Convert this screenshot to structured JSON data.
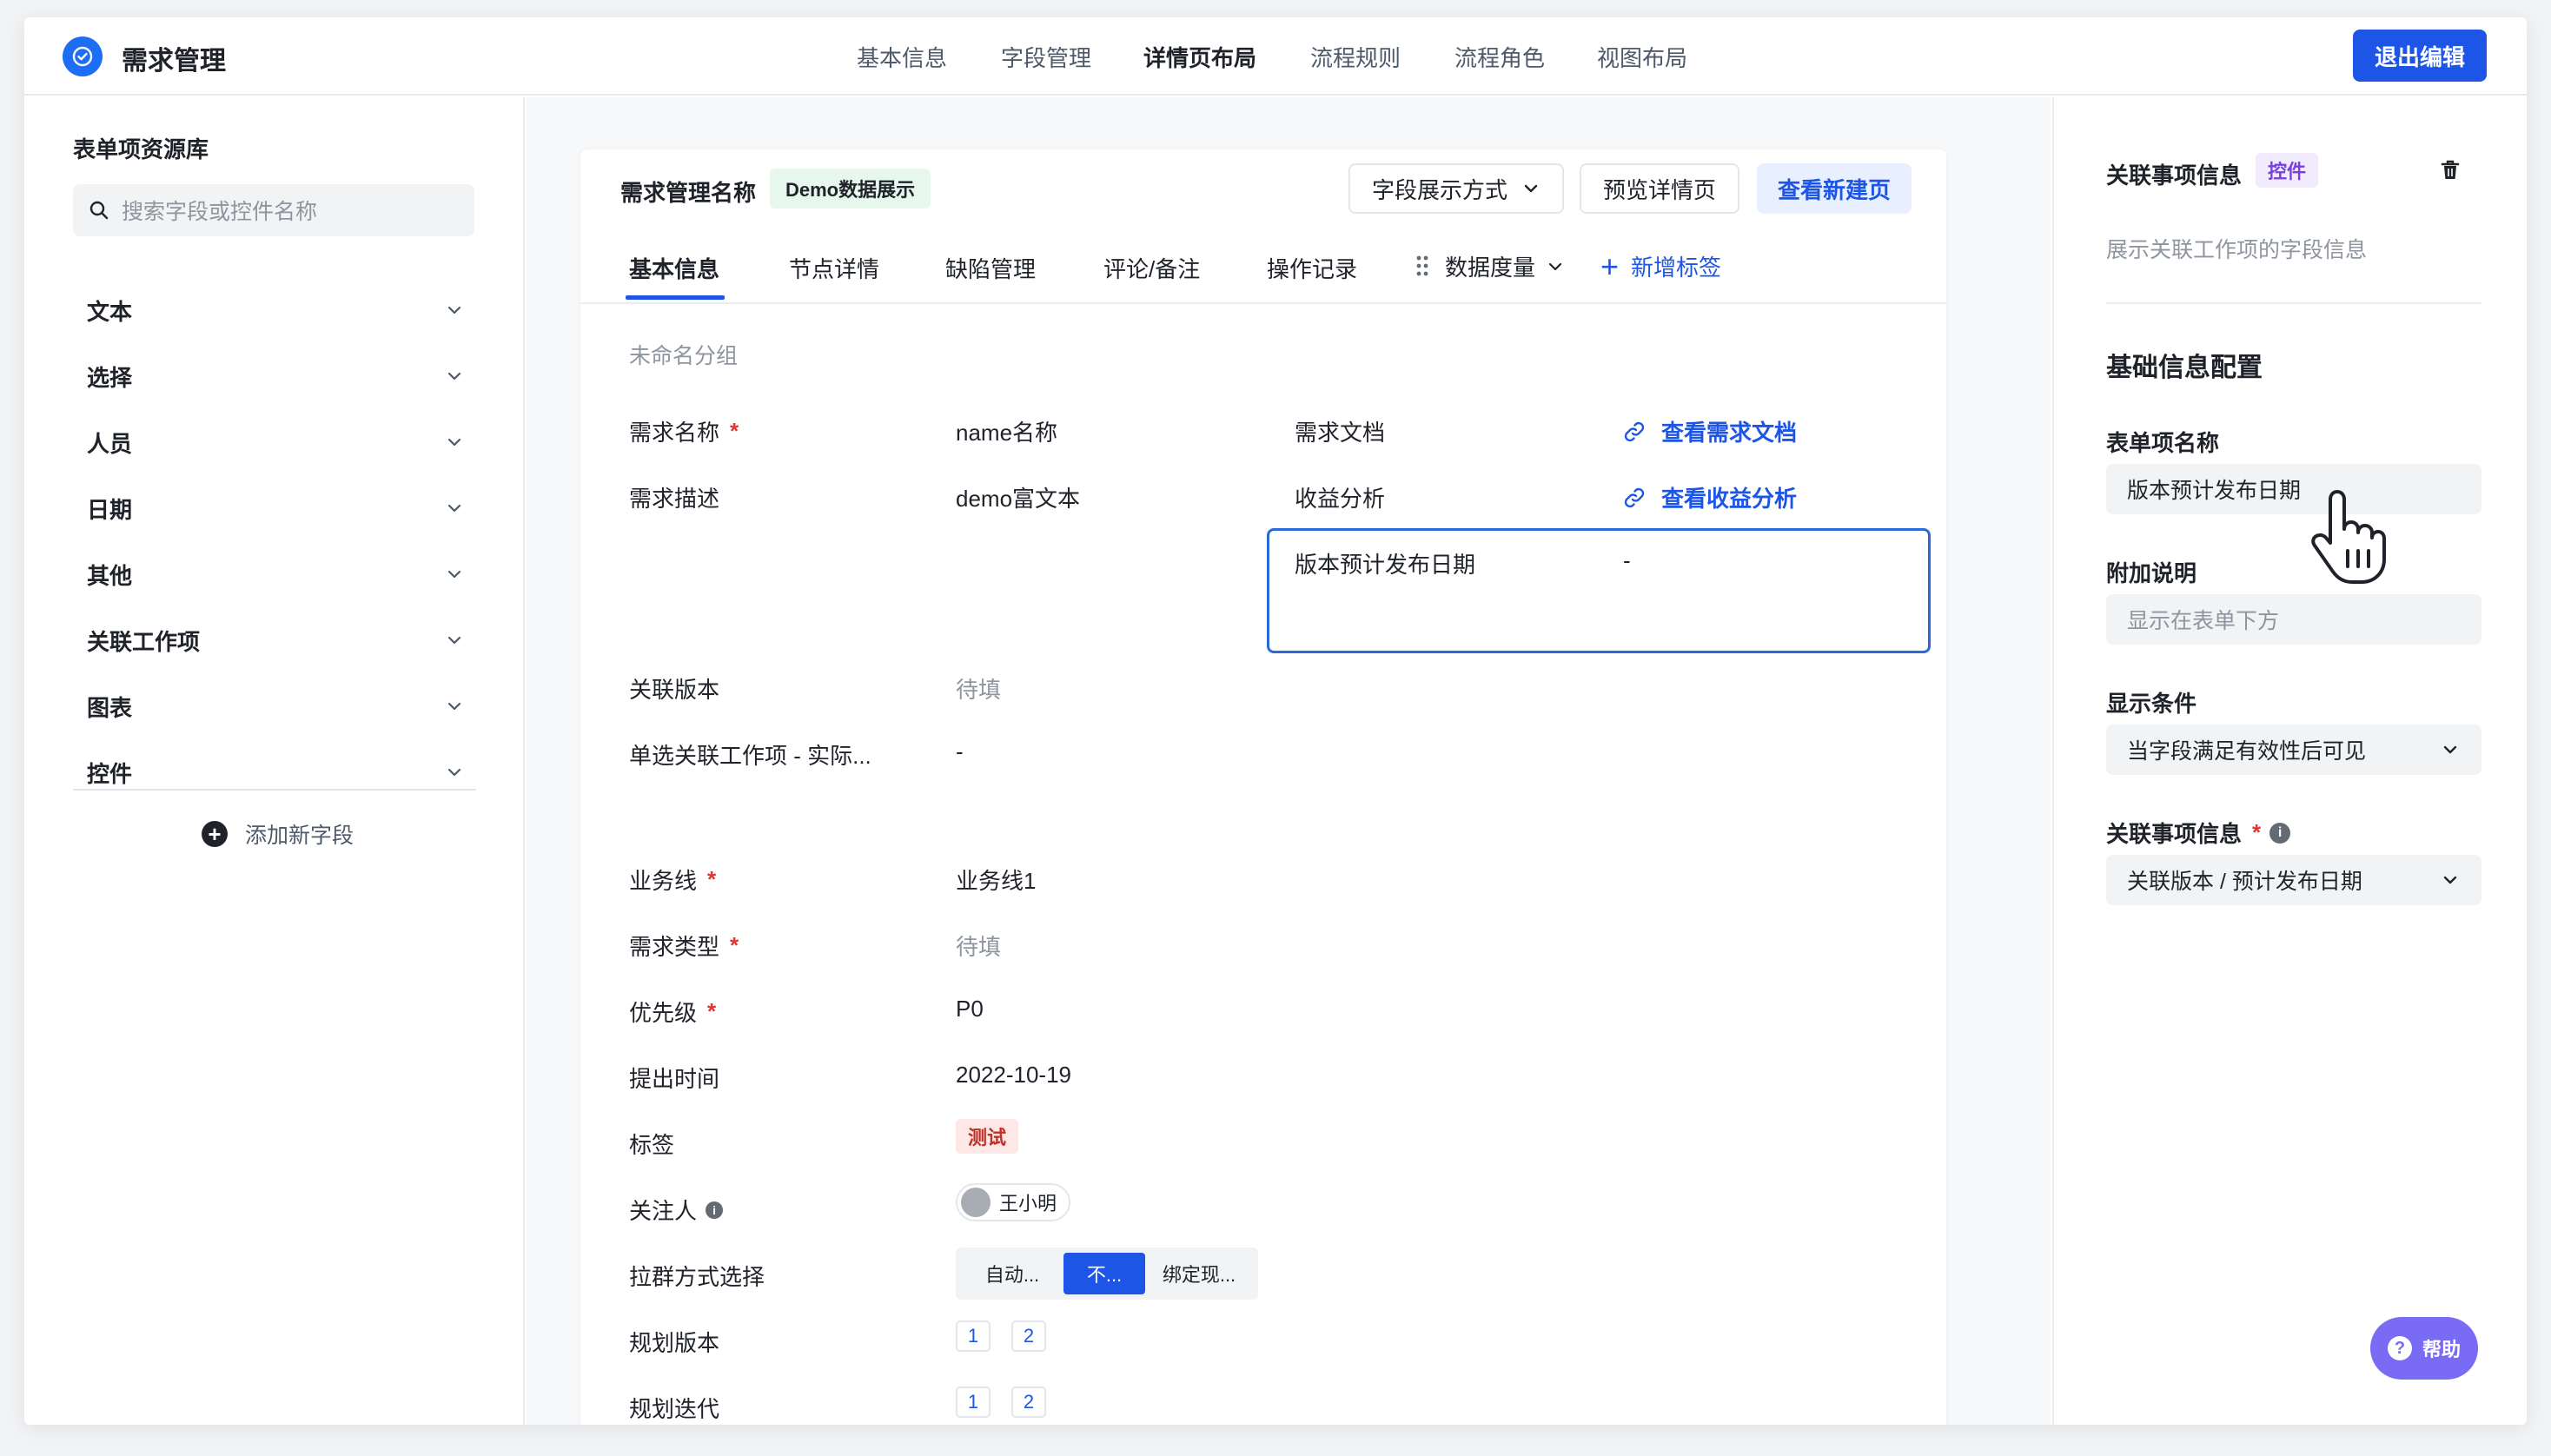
{
  "app": {
    "title": "需求管理",
    "exit_label": "退出编辑"
  },
  "topnav": [
    {
      "label": "基本信息",
      "active": false
    },
    {
      "label": "字段管理",
      "active": false
    },
    {
      "label": "详情页布局",
      "active": true
    },
    {
      "label": "流程规则",
      "active": false
    },
    {
      "label": "流程角色",
      "active": false
    },
    {
      "label": "视图布局",
      "active": false
    }
  ],
  "sidebar": {
    "title": "表单项资源库",
    "search_placeholder": "搜索字段或控件名称",
    "categories": [
      "文本",
      "选择",
      "人员",
      "日期",
      "其他",
      "关联工作项",
      "图表",
      "控件"
    ],
    "add_field": "添加新字段"
  },
  "card": {
    "title": "需求管理名称",
    "demo_tag": "Demo数据展示",
    "display_mode": "字段展示方式",
    "preview": "预览详情页",
    "view_new": "查看新建页",
    "tabs": [
      "基本信息",
      "节点详情",
      "缺陷管理",
      "评论/备注",
      "操作记录",
      "数据度量"
    ],
    "add_tab": "新增标签",
    "group_name": "未命名分组",
    "fields": {
      "name": {
        "label": "需求名称",
        "value": "name名称"
      },
      "desc": {
        "label": "需求描述",
        "value": "demo富文本"
      },
      "doc": {
        "label": "需求文档",
        "value": "查看需求文档"
      },
      "benefit": {
        "label": "收益分析",
        "value": "查看收益分析"
      },
      "release": {
        "label": "版本预计发布日期",
        "value": "-"
      },
      "version": {
        "label": "关联版本",
        "value": "待填"
      },
      "single_link": {
        "label": "单选关联工作项 - 实际...",
        "value": "-"
      },
      "biz_line": {
        "label": "业务线",
        "value": "业务线1"
      },
      "type": {
        "label": "需求类型",
        "value": "待填"
      },
      "priority": {
        "label": "优先级",
        "value": "P0"
      },
      "created": {
        "label": "提出时间",
        "value": "2022-10-19"
      },
      "tags": {
        "label": "标签",
        "value": "测试"
      },
      "followers": {
        "label": "关注人",
        "value": "王小明"
      },
      "group_mode": {
        "label": "拉群方式选择",
        "options": [
          "自动...",
          "不...",
          "绑定现..."
        ],
        "selected": "不..."
      },
      "plan_version": {
        "label": "规划版本",
        "values": [
          "1",
          "2"
        ]
      },
      "plan_iter": {
        "label": "规划迭代",
        "values": [
          "1",
          "2"
        ]
      }
    },
    "required_mark": "*"
  },
  "panel": {
    "title": "关联事项信息",
    "tag": "控件",
    "desc": "展示关联工作项的字段信息",
    "section": "基础信息配置",
    "form_name_label": "表单项名称",
    "form_name_value": "版本预计发布日期",
    "note_label": "附加说明",
    "note_placeholder": "显示在表单下方",
    "cond_label": "显示条件",
    "cond_value": "当字段满足有效性后可见",
    "link_label": "关联事项信息",
    "link_value": "关联版本 / 预计发布日期"
  },
  "help": "帮助",
  "colors": {
    "primary": "#1d56e6",
    "selection_border": "#2c6ad8",
    "required": "#e3342f",
    "help_bg": "#7a6bf5"
  }
}
